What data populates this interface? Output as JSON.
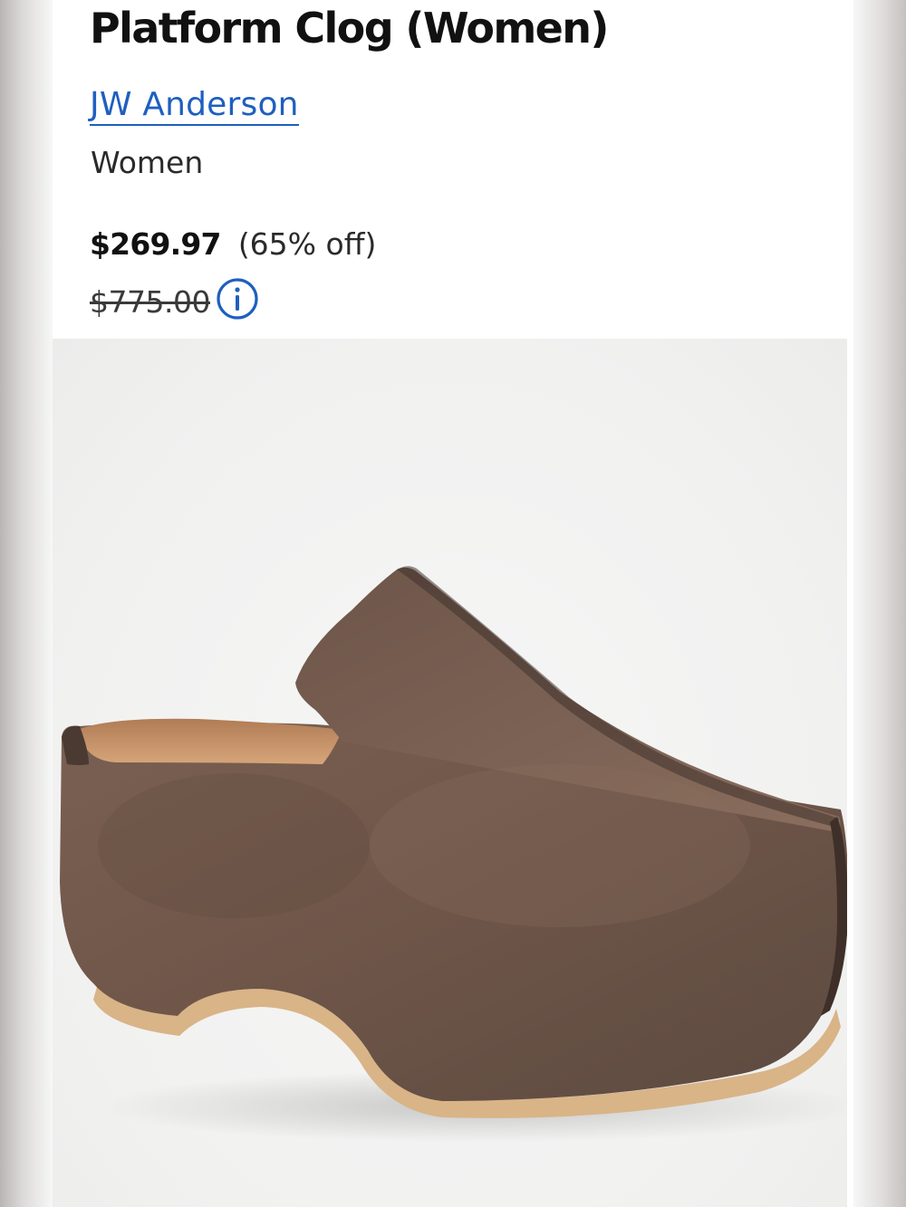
{
  "product": {
    "title": "Platform Clog (Women)",
    "brand": "JW Anderson",
    "category": "Women",
    "price": {
      "current": "$269.97",
      "discount": "(65% off)",
      "original": "$775.00"
    }
  },
  "icons": {
    "price_info": "info-circle-icon"
  },
  "colors": {
    "brand_link": "#1f5fbf",
    "clog_suede": "#6e5548",
    "sole": "#d9b487"
  }
}
